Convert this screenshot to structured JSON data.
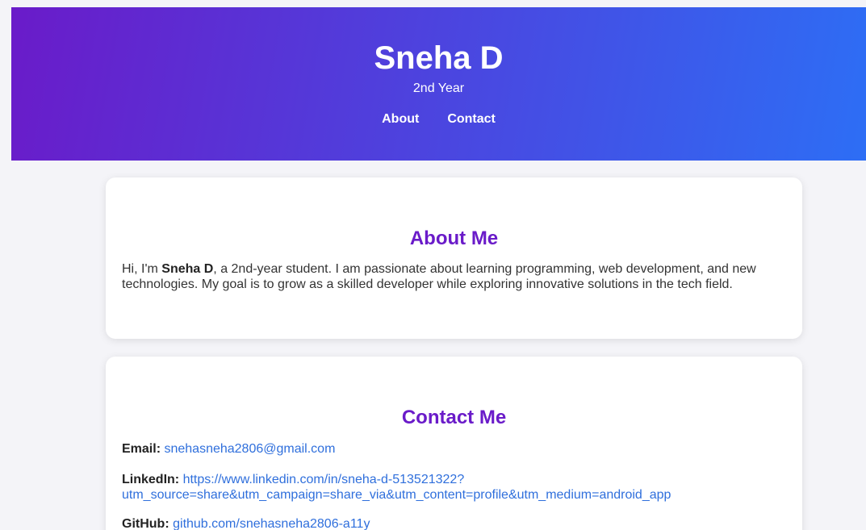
{
  "header": {
    "name": "Sneha D",
    "subtitle": "2nd Year",
    "nav": {
      "about": "About",
      "contact": "Contact"
    }
  },
  "about": {
    "heading": "About Me",
    "intro": "Hi, I'm ",
    "name": "Sneha D",
    "body": ", a 2nd-year student. I am passionate about learning programming, web development, and new technologies. My goal is to grow as a skilled developer while exploring innovative solutions in the tech field."
  },
  "contact": {
    "heading": "Contact Me",
    "email_label": "Email:",
    "email_value": "snehasneha2806@gmail.com",
    "linkedin_label": "LinkedIn:",
    "linkedin_value": "https://www.linkedin.com/in/sneha-d-513521322?utm_source=share&utm_campaign=share_via&utm_content=profile&utm_medium=android_app",
    "github_label": "GitHub:",
    "github_value": "github.com/snehasneha2806-a11y"
  },
  "colors": {
    "gradient_start": "#6a1bc9",
    "gradient_end": "#2d6ef5",
    "heading_purple": "#6a1bc9",
    "link_blue": "#2f6fdc",
    "page_bg": "#f4f4f8"
  }
}
